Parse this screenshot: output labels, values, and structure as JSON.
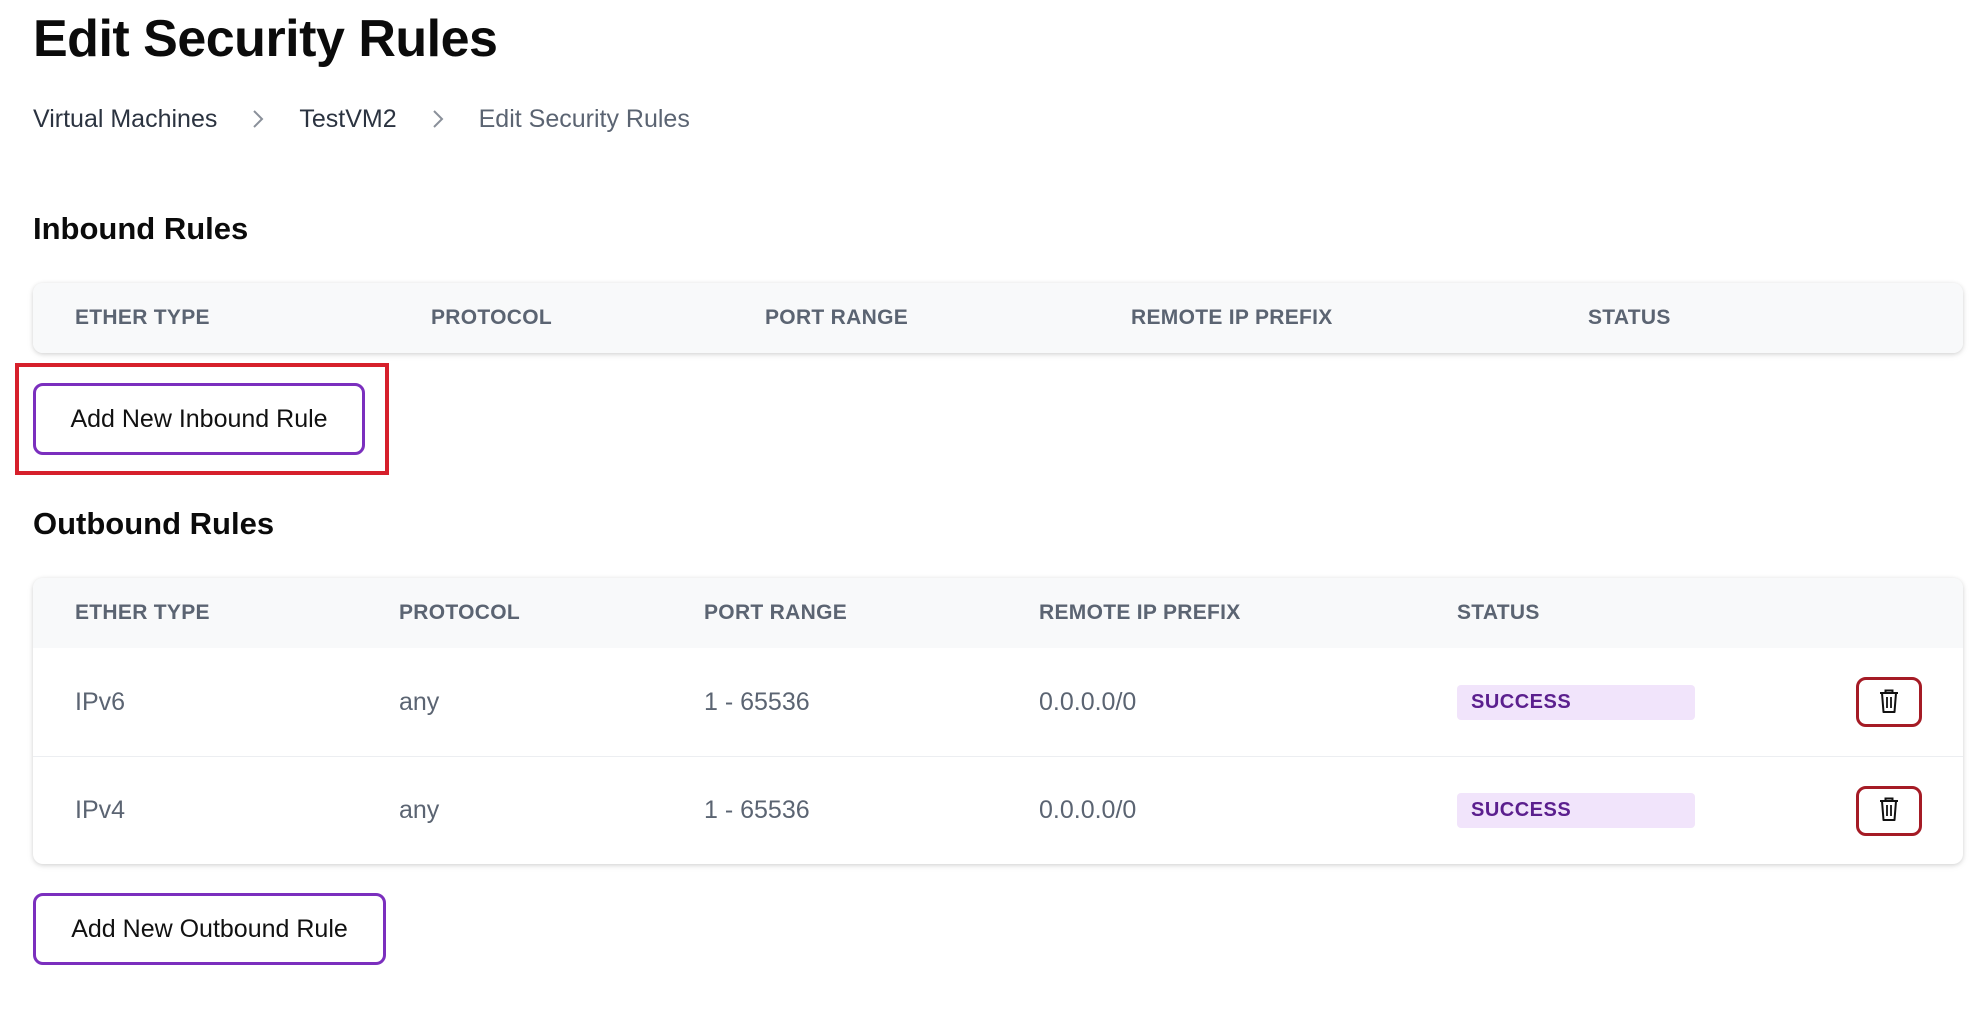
{
  "page": {
    "title": "Edit Security Rules"
  },
  "breadcrumb": {
    "items": [
      "Virtual Machines",
      "TestVM2",
      "Edit Security Rules"
    ],
    "separator_icon": "chevron-right-icon"
  },
  "inbound": {
    "title": "Inbound Rules",
    "columns": [
      "ETHER TYPE",
      "PROTOCOL",
      "PORT RANGE",
      "REMOTE IP PREFIX",
      "STATUS"
    ],
    "rows": [],
    "add_button_label": "Add New Inbound Rule",
    "highlight_color": "#d6202b"
  },
  "outbound": {
    "title": "Outbound Rules",
    "columns": [
      "ETHER TYPE",
      "PROTOCOL",
      "PORT RANGE",
      "REMOTE IP PREFIX",
      "STATUS"
    ],
    "rows": [
      {
        "ether_type": "IPv6",
        "protocol": "any",
        "port_range": "1 - 65536",
        "remote_ip_prefix": "0.0.0.0/0",
        "status": "SUCCESS",
        "action_icon": "trash-icon"
      },
      {
        "ether_type": "IPv4",
        "protocol": "any",
        "port_range": "1 - 65536",
        "remote_ip_prefix": "0.0.0.0/0",
        "status": "SUCCESS",
        "action_icon": "trash-icon"
      }
    ],
    "add_button_label": "Add New Outbound Rule"
  },
  "colors": {
    "accent": "#7b2fbe",
    "delete": "#a51b25",
    "status_bg": "#f1e4fb",
    "status_text": "#5b1f8e"
  }
}
